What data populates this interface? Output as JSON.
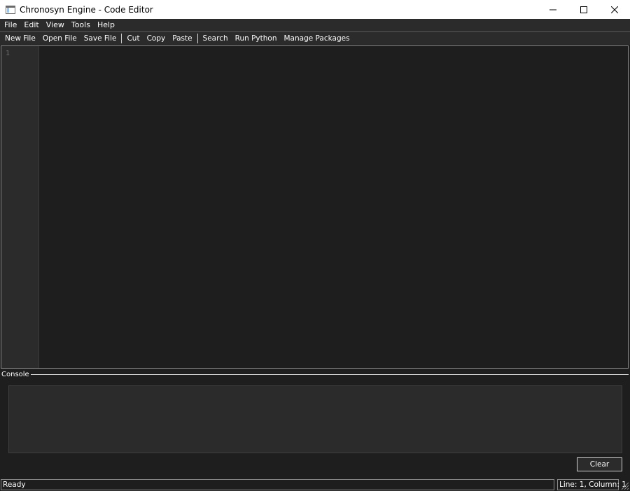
{
  "window": {
    "title": "Chronosyn Engine - Code Editor",
    "icon": "app-window-icon",
    "controls": [
      "minimize-icon",
      "maximize-icon",
      "close-icon"
    ]
  },
  "menu": {
    "items": [
      {
        "label": "File"
      },
      {
        "label": "Edit"
      },
      {
        "label": "View"
      },
      {
        "label": "Tools"
      },
      {
        "label": "Help"
      }
    ]
  },
  "toolbar": {
    "new_file": "New File",
    "open_file": "Open File",
    "save_file": "Save File",
    "cut": "Cut",
    "copy": "Copy",
    "paste": "Paste",
    "search": "Search",
    "run_python": "Run Python",
    "manage_packages": "Manage Packages"
  },
  "editor": {
    "line_number": "1",
    "content": ""
  },
  "console": {
    "label": "Console",
    "output": "",
    "clear_label": "Clear"
  },
  "status": {
    "message": "Ready",
    "position": "Line: 1, Column: 1"
  },
  "colors": {
    "background": "#1e1e1e",
    "panel": "#2b2b2b",
    "border": "#8a8a8a",
    "text": "#ffffff",
    "line_number": "#6e6e6e"
  }
}
